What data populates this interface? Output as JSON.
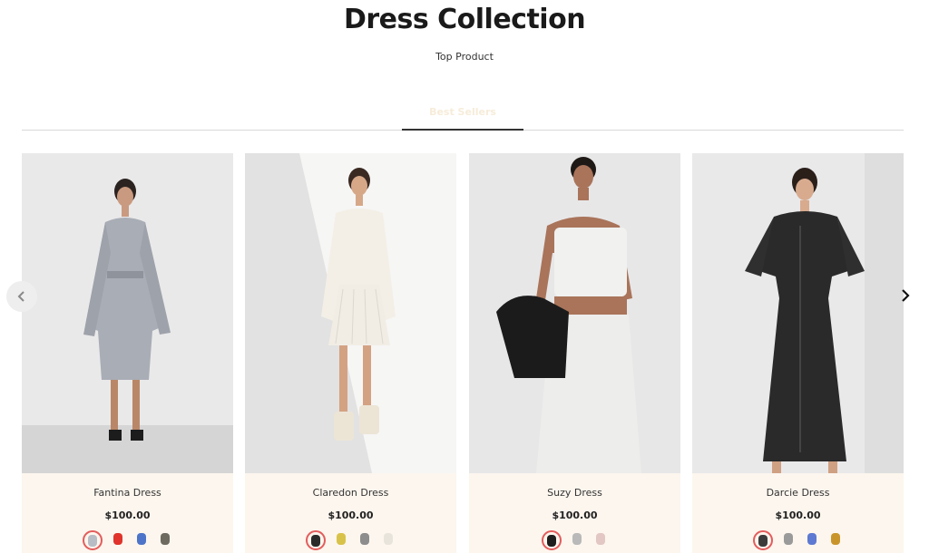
{
  "header": {
    "title": "Dress Collection",
    "subtitle": "Top Product"
  },
  "tabs": {
    "active_label": "Best Sellers"
  },
  "carousel": {
    "prev_icon": "chevron-left-icon",
    "next_icon": "chevron-right-icon"
  },
  "products": [
    {
      "name": "Fantina Dress",
      "price": "$100.00",
      "swatches": [
        "#b8bcc4",
        "#e0332b",
        "#4d74c9",
        "#6e6a60"
      ]
    },
    {
      "name": "Claredon Dress",
      "price": "$100.00",
      "swatches": [
        "#2a2a2a",
        "#d9c24a",
        "#8d8d8d",
        "#e8e4dc"
      ]
    },
    {
      "name": "Suzy Dress",
      "price": "$100.00",
      "swatches": [
        "#1e1e1e",
        "#b9b9b9",
        "#e2c7c4"
      ]
    },
    {
      "name": "Darcie Dress",
      "price": "$100.00",
      "swatches": [
        "#3b3b3b",
        "#9a9a9a",
        "#5e79d1",
        "#c9952b"
      ]
    }
  ],
  "colors": {
    "card_background": "#fcf6ee",
    "active_swatch_ring": "#e35c5c"
  }
}
